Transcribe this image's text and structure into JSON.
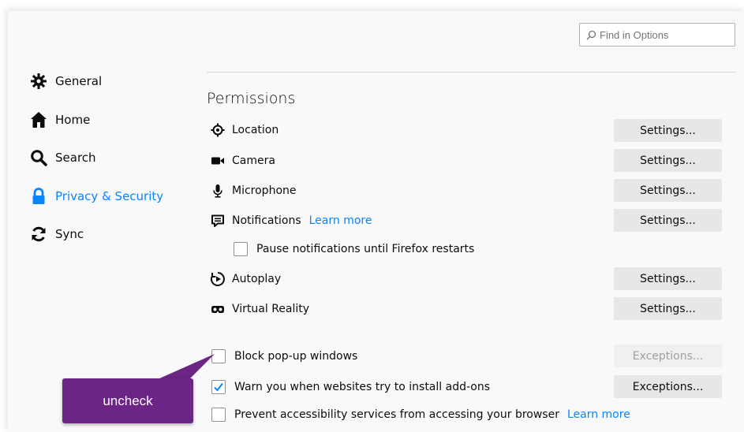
{
  "search": {
    "placeholder": "Find in Options"
  },
  "sidebar": {
    "items": [
      {
        "label": "General",
        "icon": "gear-icon"
      },
      {
        "label": "Home",
        "icon": "home-icon"
      },
      {
        "label": "Search",
        "icon": "search-icon"
      },
      {
        "label": "Privacy & Security",
        "icon": "lock-icon",
        "selected": true
      },
      {
        "label": "Sync",
        "icon": "sync-icon"
      }
    ]
  },
  "permissions": {
    "title": "Permissions",
    "rows": [
      {
        "label": "Location",
        "icon": "location-icon",
        "button": "Settings..."
      },
      {
        "label": "Camera",
        "icon": "camera-icon",
        "button": "Settings..."
      },
      {
        "label": "Microphone",
        "icon": "microphone-icon",
        "button": "Settings..."
      },
      {
        "label": "Notifications",
        "icon": "notifications-icon",
        "link": "Learn more",
        "button": "Settings..."
      },
      {
        "label": "Autoplay",
        "icon": "autoplay-icon",
        "button": "Settings..."
      },
      {
        "label": "Virtual Reality",
        "icon": "vr-icon",
        "button": "Settings..."
      }
    ],
    "pause_notifications": {
      "label": "Pause notifications until Firefox restarts",
      "checked": false
    },
    "block_popups": {
      "label": "Block pop-up windows",
      "checked": false,
      "button": "Exceptions..."
    },
    "warn_addons": {
      "label": "Warn you when websites try to install add-ons",
      "checked": true,
      "button": "Exceptions..."
    },
    "accessibility": {
      "label": "Prevent accessibility services from accessing your browser",
      "checked": false,
      "link": "Learn more"
    }
  },
  "callout": {
    "text": "uncheck"
  },
  "colors": {
    "accent": "#0a84ff",
    "callout": "#6b2585",
    "button_bg": "#e7e7e8"
  }
}
